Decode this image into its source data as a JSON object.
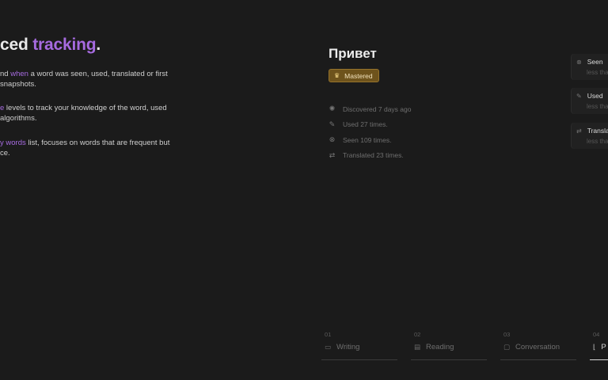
{
  "hero": {
    "title_part1": "ced ",
    "title_highlight": "tracking",
    "title_end": "."
  },
  "features": [
    {
      "line1_pre": "nd ",
      "line1_hl": "when",
      "line1_post": " a word was seen, used, translated or first",
      "line2": " snapshots."
    },
    {
      "line1_pre": "",
      "line1_hl": "e",
      "line1_post": " levels to track your knowledge of the word, used",
      "line2": "algorithms."
    },
    {
      "line1_pre": "",
      "line1_hl": "y words",
      "line1_post": " list, focuses on words that are frequent but",
      "line2": "ce."
    }
  ],
  "word": {
    "title": "Привет",
    "badge": {
      "label": "Mastered",
      "icon": "crown-icon"
    },
    "stats": [
      {
        "icon": "discover-icon",
        "glyph": "✺",
        "text": "Discovered 7 days ago"
      },
      {
        "icon": "pen-icon",
        "glyph": "✎",
        "text": "Used 27 times."
      },
      {
        "icon": "eye-icon",
        "glyph": "⊗",
        "text": "Seen 109 times."
      },
      {
        "icon": "translate-icon",
        "glyph": "⇄",
        "text": "Translated 23 times."
      }
    ]
  },
  "events": [
    {
      "icon": "eye-icon",
      "glyph": "⊗",
      "title": "Seen",
      "sub": "less tha"
    },
    {
      "icon": "pen-icon",
      "glyph": "✎",
      "title": "Used",
      "sub": "less tha"
    },
    {
      "icon": "translate-icon",
      "glyph": "⇄",
      "title": "Translat",
      "sub": "less tha"
    }
  ],
  "steps": [
    {
      "num": "01",
      "label": "Writing",
      "icon": "writing-icon",
      "glyph": "▭",
      "active": false
    },
    {
      "num": "02",
      "label": "Reading",
      "icon": "reading-icon",
      "glyph": "▤",
      "active": false
    },
    {
      "num": "03",
      "label": "Conversation",
      "icon": "chat-icon",
      "glyph": "▢",
      "active": false
    },
    {
      "num": "04",
      "label": "P",
      "icon": "chart-icon",
      "glyph": "⌊",
      "active": true
    }
  ],
  "colors": {
    "accent": "#a66be0",
    "badge_bg": "#6e531c",
    "background": "#1b1b1b"
  }
}
